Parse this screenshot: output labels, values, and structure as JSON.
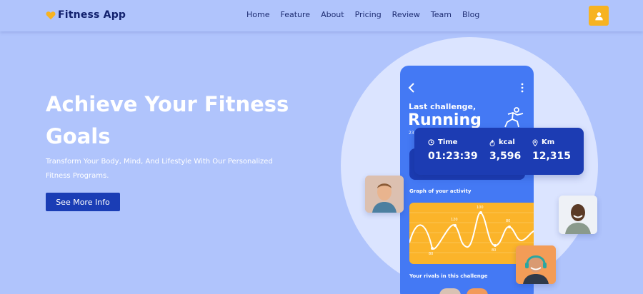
{
  "nav": {
    "brand": "Fitness App",
    "links": [
      "Home",
      "Feature",
      "About",
      "Pricing",
      "Review",
      "Team",
      "Blog"
    ],
    "profile_icon": "user-icon"
  },
  "hero": {
    "title": "Achieve Your Fitness Goals",
    "subtitle": "Transform Your Body, Mind, And Lifestyle With Our Personalized Fitness Programs.",
    "cta": "See More Info"
  },
  "phone": {
    "challenge_label": "Last challenge,",
    "challenge_name": "Running",
    "date_fragment": "23",
    "graph_label": "Graph of your activity",
    "rivals_label": "Your rivals in this challenge",
    "graph_values": [
      "80",
      "120",
      "100",
      "80",
      "80"
    ]
  },
  "stats": [
    {
      "label": "Time",
      "value": "01:23:39",
      "icon": "clock-icon"
    },
    {
      "label": "kcal",
      "value": "3,596",
      "icon": "flame-icon"
    },
    {
      "label": "Km",
      "value": "12,315",
      "icon": "location-pin-icon"
    }
  ],
  "colors": {
    "background": "#b0c4fc",
    "brand_accent": "#f7b322",
    "cta": "#1a3db5",
    "phone": "#4479f4",
    "card": "#1c3cb3",
    "graph": "#fbb42a"
  }
}
